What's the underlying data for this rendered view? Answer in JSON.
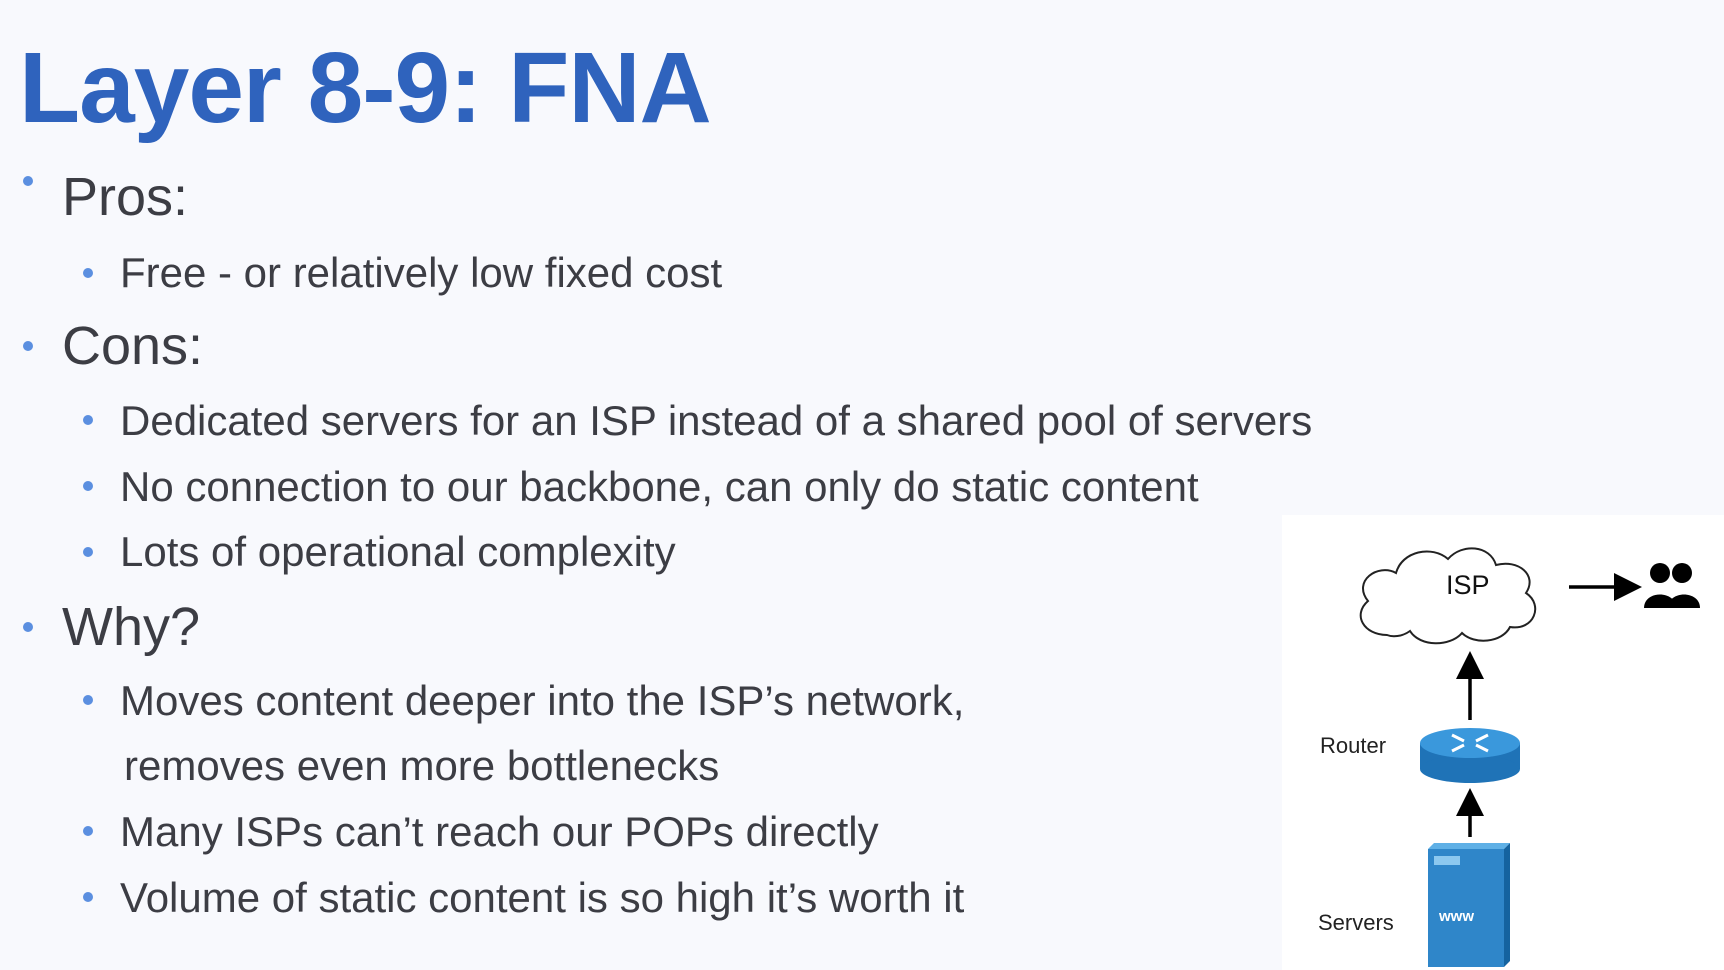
{
  "slide": {
    "title": "Layer 8-9: FNA",
    "sections": [
      {
        "heading": "Pros:",
        "items": [
          "Free - or relatively low fixed cost"
        ]
      },
      {
        "heading": "Cons:",
        "items": [
          "Dedicated servers for an ISP instead of a shared pool of servers",
          "No connection to our backbone, can only do static content",
          "Lots of operational complexity"
        ]
      },
      {
        "heading": "Why?",
        "items": [
          "Moves content deeper into the ISP’s network,",
          "removes even more bottlenecks",
          "Many ISPs can’t reach our POPs directly",
          "Volume of static content is so high it’s worth it"
        ]
      }
    ]
  },
  "diagram": {
    "cloud_label": "ISP",
    "router_label": "Router",
    "servers_label": "Servers",
    "server_badge": "www",
    "icons": [
      "cloud-icon",
      "users-icon",
      "router-icon",
      "server-icon"
    ],
    "colors": {
      "accent": "#2f63bd",
      "bullet": "#5b8fe0",
      "device": "#2f86c9"
    }
  }
}
